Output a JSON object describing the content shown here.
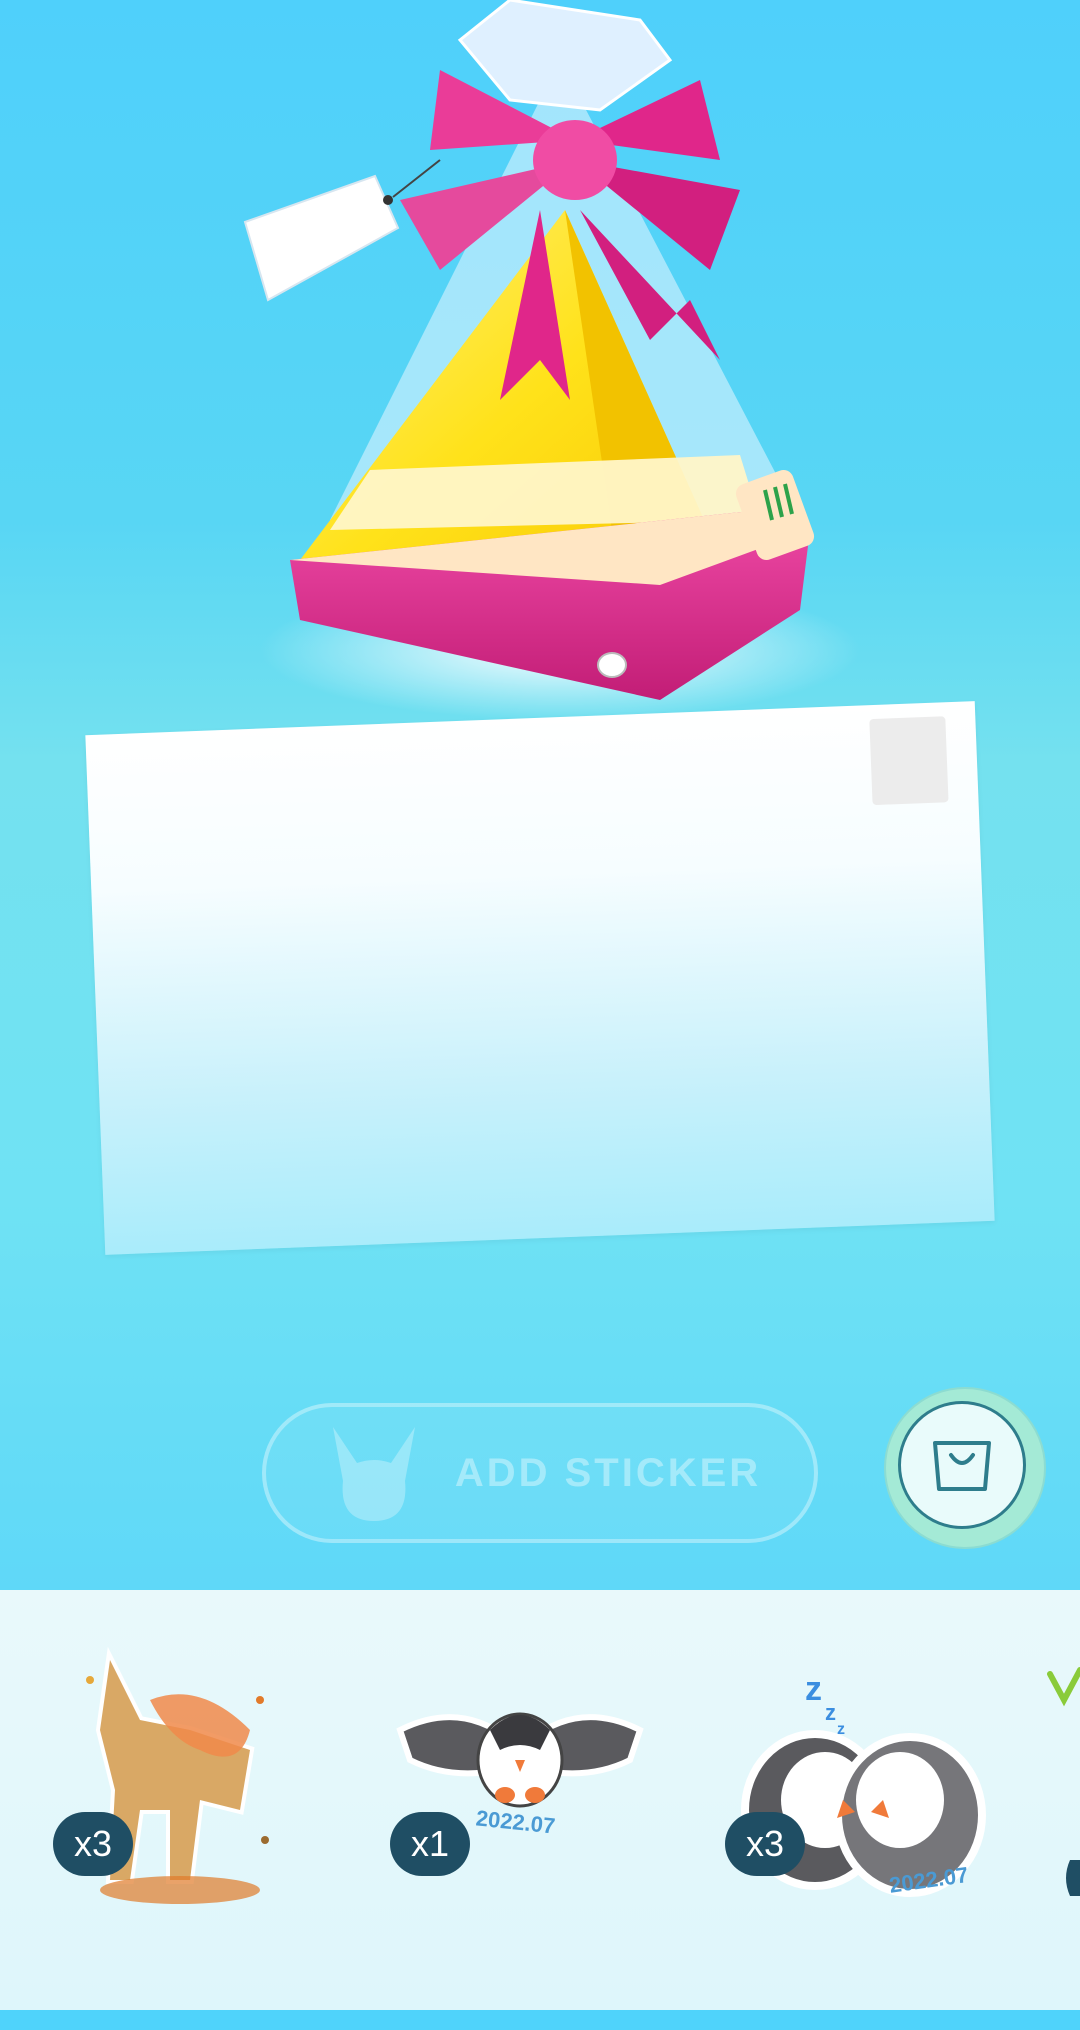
{
  "actions": {
    "add_sticker_label": "ADD STICKER"
  },
  "icons": {
    "pokeball_face": "pikachu-silhouette-icon",
    "shop": "shopping-bag-icon"
  },
  "colors": {
    "background_top": "#4fd0fb",
    "postcard": "#ffffff",
    "badge": "#1f4e64",
    "gift_ribbon": "#e0268a",
    "gift_body": "#ffe21a"
  },
  "stickers": [
    {
      "name": "Deer (autumn)",
      "count": "x3",
      "date": ""
    },
    {
      "name": "Starly flying",
      "count": "x1",
      "date": "2022.07"
    },
    {
      "name": "Starly pair sleeping",
      "count": "x3",
      "date": "2022.07"
    }
  ]
}
